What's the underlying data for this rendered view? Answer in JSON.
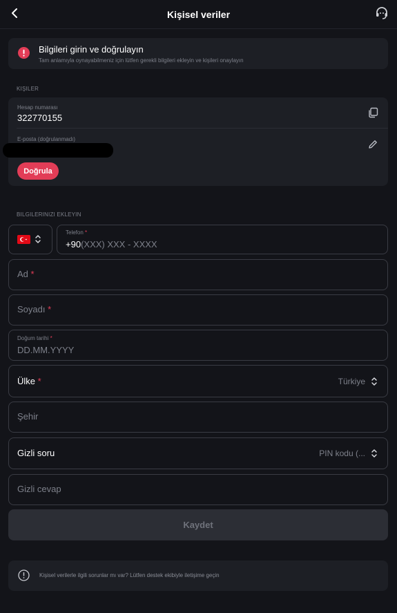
{
  "header": {
    "title": "Kişisel veriler"
  },
  "alert": {
    "title": "Bilgileri girin ve doğrulayın",
    "subtitle": "Tam anlamıyla oynayabilmeniz için lütfen gerekli bilgileri ekleyin ve kişileri onaylayın"
  },
  "contacts": {
    "section_label": "KIŞILER",
    "account_label": "Hesap numarası",
    "account_value": "322770155",
    "email_label": "E-posta (doğrulanmadı)",
    "verify_label": "Doğrula"
  },
  "form": {
    "section_label": "BILGILERINIZI EKLEYIN",
    "phone_label": "Telefon",
    "phone_prefix": "+90",
    "phone_placeholder": "(XXX) XXX - XXXX",
    "first_name": "Ad",
    "last_name": "Soyadı",
    "birth_label": "Doğum tarihi",
    "birth_placeholder": "DD.MM.YYYY",
    "country_label": "Ülke",
    "country_value": "Türkiye",
    "city": "Şehir",
    "secret_question_label": "Gizli soru",
    "secret_question_value": "PIN kodu (...",
    "secret_answer": "Gizli cevap",
    "required_mark": "*",
    "save_label": "Kaydet"
  },
  "help": {
    "text": "Kişisel verilerle ilgili sorunlar mı var? Lütfen destek ekibiyle iletişime geçin"
  },
  "colors": {
    "background": "#131419",
    "card": "#1d1f25",
    "accent": "#e23d57",
    "border": "#3a3c44",
    "muted": "#7d808a"
  },
  "icons": [
    "chevron-left-icon",
    "support-headset-icon",
    "alert-icon",
    "copy-icon",
    "pencil-icon",
    "turkey-flag-icon",
    "chevron-updown-icon",
    "info-icon"
  ]
}
